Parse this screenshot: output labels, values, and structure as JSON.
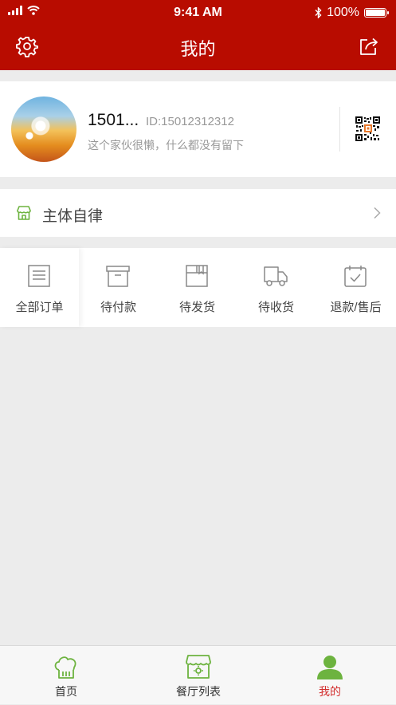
{
  "status_bar": {
    "time": "9:41 AM",
    "battery": "100%",
    "battery_level": 1.0
  },
  "header": {
    "title": "我的",
    "settings_icon": "gear-icon",
    "share_icon": "share-icon"
  },
  "profile": {
    "username": "1501...",
    "user_id": "ID:15012312312",
    "bio": "这个家伙很懒，什么都没有留下"
  },
  "menu": {
    "self_discipline": "主体自律"
  },
  "orders": [
    {
      "label": "全部订单",
      "icon": "document-icon"
    },
    {
      "label": "待付款",
      "icon": "archive-box-icon"
    },
    {
      "label": "待发货",
      "icon": "package-icon"
    },
    {
      "label": "待收货",
      "icon": "truck-icon"
    },
    {
      "label": "退款/售后",
      "icon": "calendar-check-icon"
    }
  ],
  "tabs": [
    {
      "label": "首页",
      "icon": "chef-hat-icon",
      "active": false
    },
    {
      "label": "餐厅列表",
      "icon": "restaurant-icon",
      "active": false
    },
    {
      "label": "我的",
      "icon": "user-icon",
      "active": true
    }
  ],
  "colors": {
    "brand_red": "#b80c00",
    "active_tab": "#d32f2f",
    "icon_green": "#6db33f"
  }
}
